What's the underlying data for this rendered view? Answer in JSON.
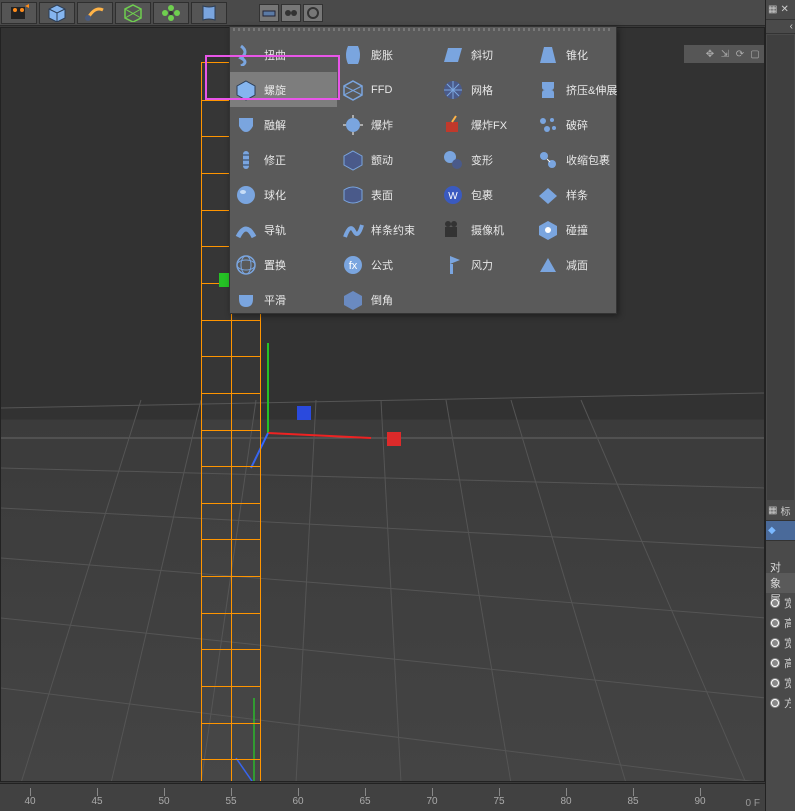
{
  "topbar": {
    "tools": [
      "movie",
      "cube",
      "brush",
      "mesh",
      "flower",
      "bulge"
    ],
    "smalltools": [
      "seg",
      "eye",
      "circle"
    ]
  },
  "viewport": {
    "nav_icons": [
      "↕",
      "↔",
      "⟳",
      "□"
    ],
    "ruler": {
      "start": 40,
      "step": 5,
      "count": 11
    },
    "footer_right": "0 F"
  },
  "dropdown": {
    "columns": [
      [
        {
          "icon": "twist",
          "label": "扭曲"
        },
        {
          "icon": "spiral",
          "label": "螺旋",
          "highlight": true,
          "annotated": true
        },
        {
          "icon": "melt",
          "label": "融解"
        },
        {
          "icon": "fix",
          "label": "修正"
        },
        {
          "icon": "sphere",
          "label": "球化"
        },
        {
          "icon": "rail",
          "label": "导轨"
        },
        {
          "icon": "displace",
          "label": "置换"
        },
        {
          "icon": "smooth",
          "label": "平滑"
        }
      ],
      [
        {
          "icon": "bulge",
          "label": "膨胀"
        },
        {
          "icon": "ffd",
          "label": "FFD"
        },
        {
          "icon": "explode",
          "label": "爆炸"
        },
        {
          "icon": "jitter",
          "label": "颤动"
        },
        {
          "icon": "surface",
          "label": "表面"
        },
        {
          "icon": "splinewrap",
          "label": "样条约束"
        },
        {
          "icon": "formula",
          "label": "公式"
        },
        {
          "icon": "bevel",
          "label": "倒角"
        }
      ],
      [
        {
          "icon": "shear",
          "label": "斜切"
        },
        {
          "icon": "lattice",
          "label": "网格"
        },
        {
          "icon": "explodefx",
          "label": "爆炸FX"
        },
        {
          "icon": "deform",
          "label": "变形"
        },
        {
          "icon": "wrap",
          "label": "包裹"
        },
        {
          "icon": "camera",
          "label": "摄像机"
        },
        {
          "icon": "wind",
          "label": "风力"
        }
      ],
      [
        {
          "icon": "taper",
          "label": "锥化"
        },
        {
          "icon": "extrude",
          "label": "挤压&伸展"
        },
        {
          "icon": "shatter",
          "label": "破碎"
        },
        {
          "icon": "shrinkwrap",
          "label": "收缩包裹"
        },
        {
          "icon": "spline",
          "label": "样条"
        },
        {
          "icon": "collision",
          "label": "碰撞"
        },
        {
          "icon": "decay",
          "label": "减面"
        }
      ]
    ]
  },
  "sidepanel": {
    "top_icon": "grid",
    "tab1": "标",
    "tab2": "对象属",
    "props": [
      "宽",
      "高",
      "宽",
      "高",
      "宽",
      "方"
    ]
  },
  "colors": {
    "accent_orange": "#ff9500",
    "accent_magenta": "#e855e8",
    "icon_blue": "#7aa5df",
    "icon_dark": "#4a5a7a"
  }
}
